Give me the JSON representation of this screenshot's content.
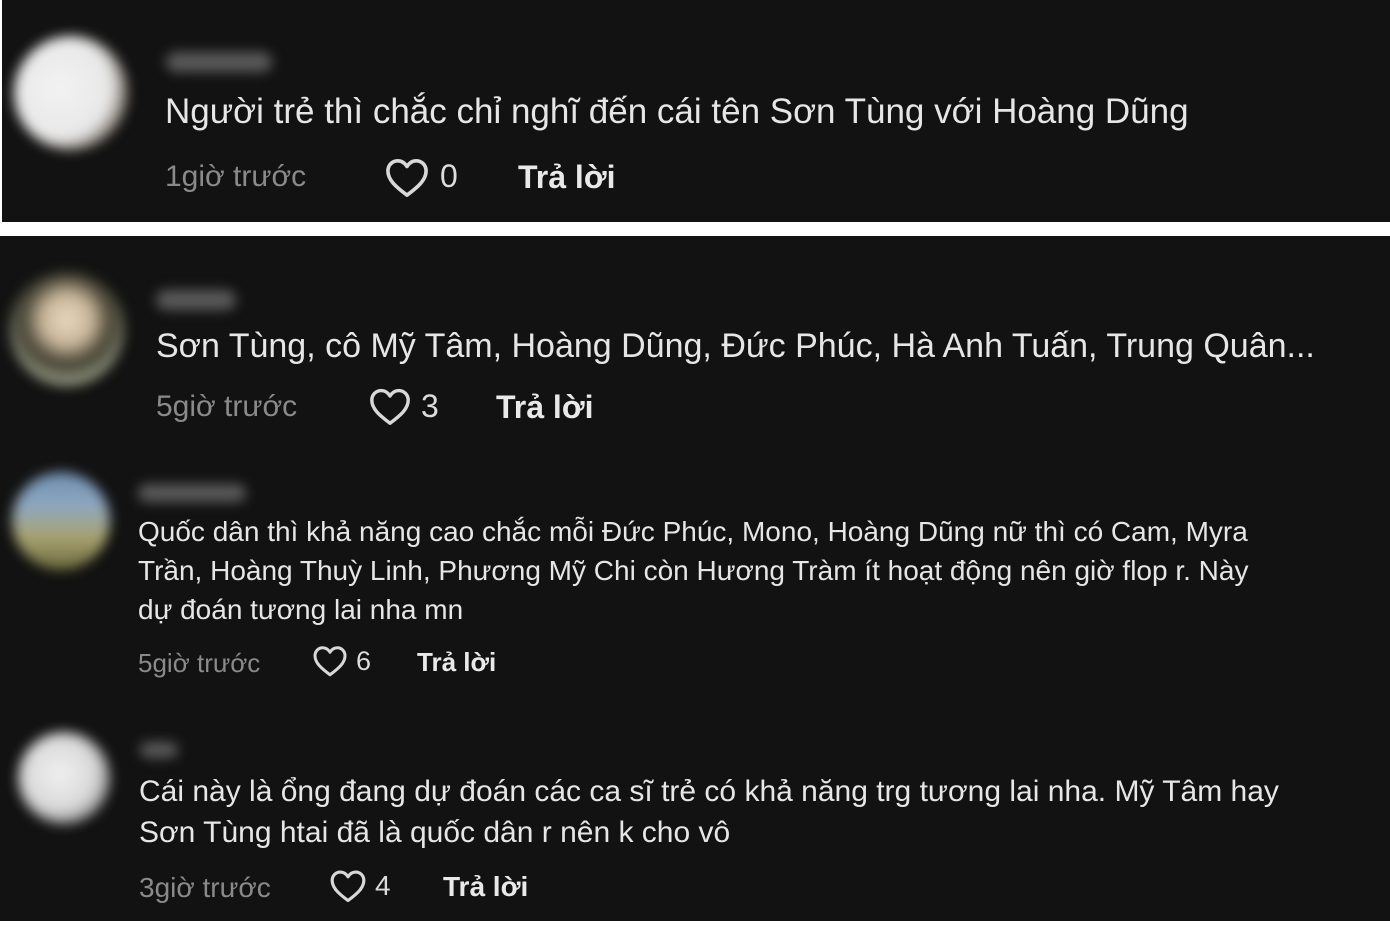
{
  "comments": [
    {
      "text": "Người trẻ thì chắc chỉ nghĩ đến cái tên Sơn Tùng với Hoàng Dũng",
      "time": "1giờ trước",
      "likes": "0",
      "reply": "Trả lời"
    },
    {
      "text": "Sơn Tùng, cô Mỹ Tâm, Hoàng Dũng, Đức Phúc, Hà Anh Tuấn, Trung Quân...",
      "time": "5giờ trước",
      "likes": "3",
      "reply": "Trả lời"
    },
    {
      "lines": [
        "Quốc dân thì khả năng cao chắc mỗi Đức Phúc, Mono, Hoàng Dũng nữ thì có Cam, Myra",
        "Trần, Hoàng Thuỳ Linh, Phương Mỹ Chi còn Hương Tràm ít hoạt động nên giờ flop r. Này",
        "dự đoán tương lai nha mn"
      ],
      "time": "5giờ trước",
      "likes": "6",
      "reply": "Trả lời"
    },
    {
      "lines": [
        "Cái này là ổng đang dự đoán các ca sĩ trẻ có khả năng trg tương lai nha. Mỹ Tâm hay",
        "Sơn Tùng htai đã là quốc dân r nên k cho vô"
      ],
      "time": "3giờ trước",
      "likes": "4",
      "reply": "Trả lời"
    }
  ],
  "colors": {
    "background": "#121212",
    "text": "#e6e6e6",
    "muted": "#8a8a8a"
  },
  "icons": {
    "like": "heart-outline-icon"
  }
}
